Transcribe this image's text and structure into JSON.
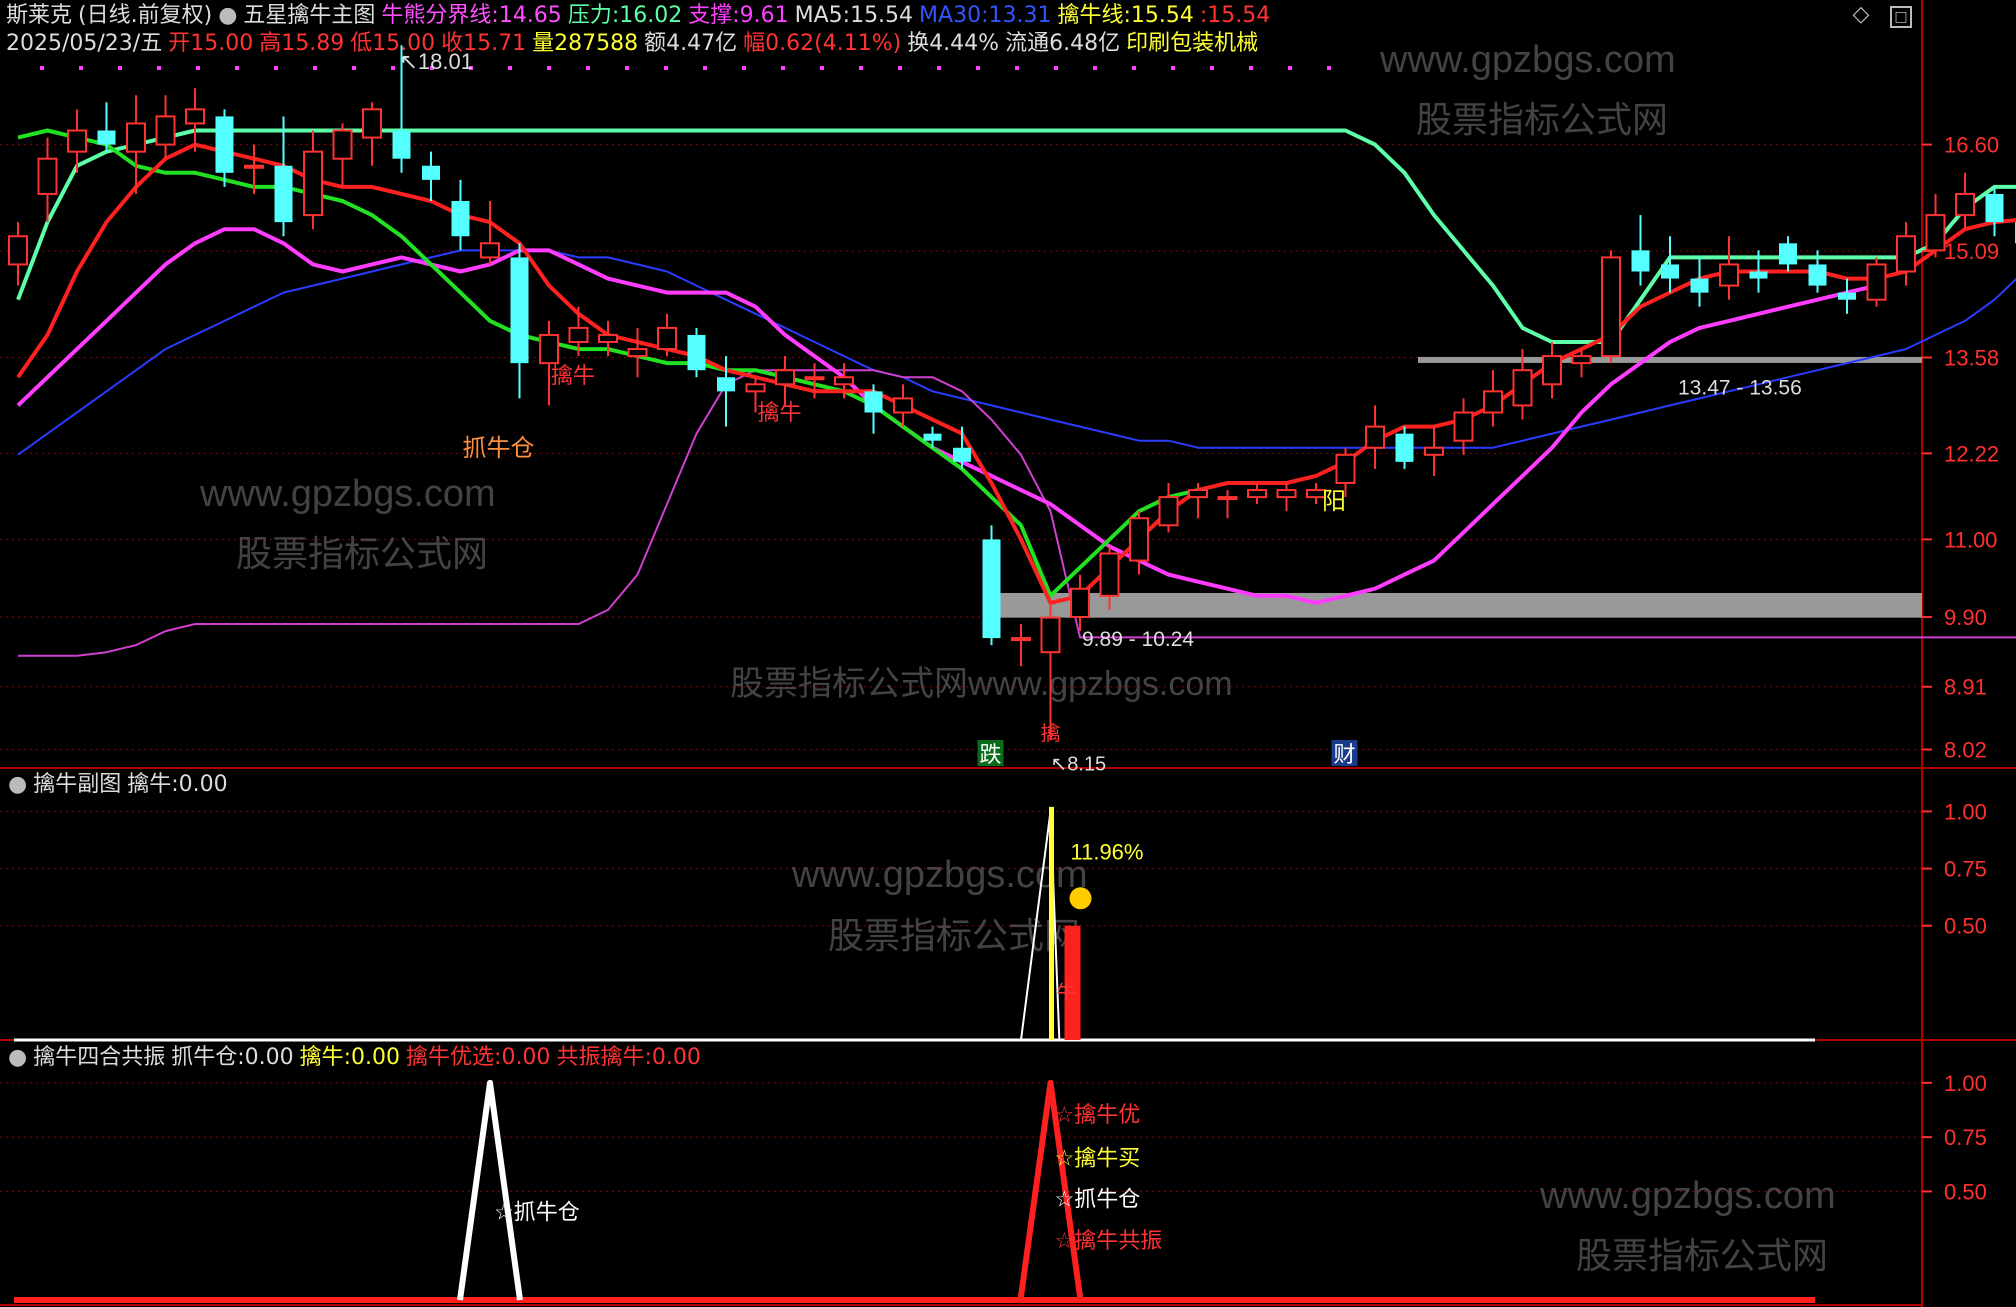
{
  "header": {
    "stock_name": "斯莱克",
    "period": "(日线.前复权)",
    "indicator": "五星擒牛主图",
    "items": [
      {
        "label": "牛熊分界线:",
        "value": "14.65",
        "color": "#ff4fff"
      },
      {
        "label": "压力:",
        "value": "16.02",
        "color": "#5dffa8"
      },
      {
        "label": "支撑:",
        "value": "9.61",
        "color": "#ff40ff"
      },
      {
        "label": "MA5:",
        "value": "15.54",
        "color": "#dddddd"
      },
      {
        "label": "MA30:",
        "value": "13.31",
        "color": "#3355ff"
      },
      {
        "label": "擒牛线:",
        "value": "15.54",
        "color": "#ffff33"
      },
      {
        "label": ":",
        "value": "15.54",
        "color": "#ff3333"
      }
    ],
    "row2": [
      {
        "label": "2025/05/23/五",
        "value": "",
        "color": "#dddddd"
      },
      {
        "label": "开",
        "value": "15.00",
        "color": "#ff3333"
      },
      {
        "label": "高",
        "value": "15.89",
        "color": "#ff3333"
      },
      {
        "label": "低",
        "value": "15.00",
        "color": "#ff3333"
      },
      {
        "label": "收",
        "value": "15.71",
        "color": "#ff3333"
      },
      {
        "label": "量",
        "value": "287588",
        "color": "#ffff33"
      },
      {
        "label": "额",
        "value": "4.47亿",
        "color": "#dddddd"
      },
      {
        "label": "幅",
        "value": "0.62(4.11%)",
        "color": "#ff3333"
      },
      {
        "label": "换",
        "value": "4.44%",
        "color": "#dddddd"
      },
      {
        "label": "流通",
        "value": "6.48亿",
        "color": "#dddddd"
      },
      {
        "label": "印刷包装机械",
        "value": "",
        "color": "#ffff33"
      }
    ],
    "sub1_title": "擒牛副图",
    "sub1_items": [
      {
        "label": "擒牛:",
        "value": "0.00",
        "color": "#dddddd"
      }
    ],
    "sub2_title": "擒牛四合共振",
    "sub2_items": [
      {
        "label": "抓牛仓:",
        "value": "0.00",
        "color": "#dddddd"
      },
      {
        "label": "擒牛:",
        "value": "0.00",
        "color": "#ffff33"
      },
      {
        "label": "擒牛优选:",
        "value": "0.00",
        "color": "#ff3333"
      },
      {
        "label": "共振擒牛:",
        "value": "0.00",
        "color": "#ff3333"
      }
    ]
  },
  "watermarks": [
    "www.gpzbgs.com",
    "股票指标公式网",
    "股票指标公式网www.gpzbgs.com"
  ],
  "chart_data": [
    {
      "type": "candlestick",
      "ylim": [
        7.8,
        17.8
      ],
      "y_ticks": [
        16.6,
        15.09,
        13.58,
        12.22,
        11.0,
        9.9,
        8.91,
        8.02
      ],
      "bars_ohlc": [
        [
          14.9,
          15.5,
          14.6,
          15.3
        ],
        [
          15.9,
          16.7,
          15.5,
          16.4
        ],
        [
          16.5,
          17.1,
          16.2,
          16.8
        ],
        [
          16.8,
          17.2,
          16.5,
          16.6
        ],
        [
          16.5,
          17.3,
          15.9,
          16.9
        ],
        [
          16.6,
          17.3,
          16.4,
          17.0
        ],
        [
          16.9,
          17.4,
          16.5,
          17.1
        ],
        [
          17.0,
          17.1,
          16.0,
          16.2
        ],
        [
          16.3,
          16.6,
          15.9,
          16.3
        ],
        [
          16.3,
          17.0,
          15.3,
          15.5
        ],
        [
          15.6,
          16.8,
          15.4,
          16.5
        ],
        [
          16.4,
          16.9,
          16.0,
          16.8
        ],
        [
          16.7,
          17.2,
          16.3,
          17.1
        ],
        [
          16.8,
          18.01,
          16.2,
          16.4
        ],
        [
          16.3,
          16.5,
          15.8,
          16.1
        ],
        [
          15.8,
          16.1,
          15.1,
          15.3
        ],
        [
          15.0,
          15.8,
          14.9,
          15.2
        ],
        [
          15.0,
          15.2,
          13.0,
          13.5
        ],
        [
          13.5,
          14.1,
          12.9,
          13.9
        ],
        [
          13.8,
          14.3,
          13.6,
          14.0
        ],
        [
          13.8,
          14.1,
          13.6,
          13.9
        ],
        [
          13.6,
          14.0,
          13.3,
          13.7
        ],
        [
          13.7,
          14.2,
          13.6,
          14.0
        ],
        [
          13.9,
          14.0,
          13.3,
          13.4
        ],
        [
          13.3,
          13.6,
          12.6,
          13.1
        ],
        [
          13.1,
          13.3,
          12.8,
          13.2
        ],
        [
          13.2,
          13.6,
          12.9,
          13.4
        ],
        [
          13.3,
          13.5,
          13.0,
          13.3
        ],
        [
          13.2,
          13.5,
          13.0,
          13.3
        ],
        [
          13.1,
          13.2,
          12.5,
          12.8
        ],
        [
          12.8,
          13.2,
          12.6,
          13.0
        ],
        [
          12.5,
          12.6,
          12.3,
          12.4
        ],
        [
          12.3,
          12.6,
          12.0,
          12.1
        ],
        [
          11.0,
          11.2,
          9.5,
          9.6
        ],
        [
          9.6,
          9.8,
          9.2,
          9.6
        ],
        [
          9.4,
          10.1,
          8.15,
          9.89
        ],
        [
          9.9,
          10.5,
          9.7,
          10.3
        ],
        [
          10.2,
          10.9,
          10.0,
          10.8
        ],
        [
          10.7,
          11.4,
          10.5,
          11.3
        ],
        [
          11.2,
          11.8,
          11.1,
          11.6
        ],
        [
          11.6,
          11.8,
          11.3,
          11.7
        ],
        [
          11.6,
          11.7,
          11.3,
          11.6
        ],
        [
          11.6,
          11.8,
          11.5,
          11.7
        ],
        [
          11.6,
          11.8,
          11.4,
          11.7
        ],
        [
          11.6,
          11.8,
          11.5,
          11.7
        ],
        [
          11.8,
          12.3,
          11.6,
          12.2
        ],
        [
          12.3,
          12.9,
          12.0,
          12.6
        ],
        [
          12.5,
          12.6,
          12.0,
          12.1
        ],
        [
          12.2,
          12.6,
          11.9,
          12.3
        ],
        [
          12.4,
          13.0,
          12.2,
          12.8
        ],
        [
          12.8,
          13.4,
          12.6,
          13.1
        ],
        [
          12.9,
          13.7,
          12.7,
          13.4
        ],
        [
          13.2,
          13.8,
          13.0,
          13.6
        ],
        [
          13.5,
          13.7,
          13.3,
          13.6
        ],
        [
          13.6,
          15.1,
          13.5,
          15.0
        ],
        [
          15.1,
          15.6,
          14.6,
          14.8
        ],
        [
          14.9,
          15.3,
          14.5,
          14.7
        ],
        [
          14.7,
          15.0,
          14.3,
          14.5
        ],
        [
          14.6,
          15.3,
          14.4,
          14.9
        ],
        [
          14.8,
          15.1,
          14.5,
          14.7
        ],
        [
          15.2,
          15.3,
          14.8,
          14.9
        ],
        [
          14.9,
          15.1,
          14.5,
          14.6
        ],
        [
          14.5,
          14.7,
          14.2,
          14.4
        ],
        [
          14.4,
          15.0,
          14.3,
          14.9
        ],
        [
          14.8,
          15.5,
          14.6,
          15.3
        ],
        [
          15.1,
          15.9,
          15.0,
          15.6
        ],
        [
          15.6,
          16.2,
          15.4,
          15.9
        ],
        [
          15.9,
          16.0,
          15.3,
          15.5
        ],
        [
          15.5,
          15.8,
          15.0,
          15.2
        ],
        [
          15.0,
          15.89,
          15.0,
          15.71
        ]
      ],
      "lines": {
        "resistance": [
          14.4,
          15.5,
          16.3,
          16.5,
          16.6,
          16.7,
          16.8,
          16.8,
          16.8,
          16.8,
          16.8,
          16.8,
          16.8,
          16.8,
          16.8,
          16.8,
          16.8,
          16.8,
          16.8,
          16.8,
          16.8,
          16.8,
          16.8,
          16.8,
          16.8,
          16.8,
          16.8,
          16.8,
          16.8,
          16.8,
          16.8,
          16.8,
          16.8,
          16.8,
          16.8,
          16.8,
          16.8,
          16.8,
          16.8,
          16.8,
          16.8,
          16.8,
          16.8,
          16.8,
          16.8,
          16.8,
          16.6,
          16.2,
          15.6,
          15.1,
          14.6,
          14.0,
          13.8,
          13.8,
          13.8,
          14.4,
          15.0,
          15.0,
          15.0,
          15.0,
          15.0,
          15.0,
          15.0,
          15.0,
          15.0,
          15.2,
          15.7,
          16.0,
          16.0,
          16.0
        ],
        "bull_line": [
          13.3,
          13.9,
          14.8,
          15.5,
          16.0,
          16.4,
          16.6,
          16.5,
          16.4,
          16.3,
          16.1,
          16.0,
          16.0,
          15.9,
          15.8,
          15.6,
          15.5,
          15.2,
          14.6,
          14.2,
          13.9,
          13.8,
          13.7,
          13.6,
          13.4,
          13.3,
          13.2,
          13.1,
          13.1,
          13.1,
          12.9,
          12.7,
          12.5,
          11.8,
          11.0,
          10.1,
          10.2,
          10.6,
          11.0,
          11.4,
          11.7,
          11.8,
          11.8,
          11.8,
          11.9,
          12.1,
          12.4,
          12.6,
          12.6,
          12.7,
          12.9,
          13.2,
          13.5,
          13.7,
          13.9,
          14.3,
          14.5,
          14.7,
          14.8,
          14.8,
          14.8,
          14.8,
          14.7,
          14.7,
          14.8,
          15.1,
          15.4,
          15.5,
          15.54,
          15.54
        ],
        "ma_green": [
          16.7,
          16.8,
          16.7,
          16.6,
          16.3,
          16.2,
          16.2,
          16.1,
          16.0,
          16.0,
          15.9,
          15.8,
          15.6,
          15.3,
          14.9,
          14.5,
          14.1,
          13.9,
          13.8,
          13.7,
          13.7,
          13.6,
          13.5,
          13.5,
          13.4,
          13.4,
          13.3,
          13.2,
          13.1,
          12.9,
          12.6,
          12.3,
          12.0,
          11.6,
          11.2,
          10.2,
          10.6,
          11.0,
          11.4,
          11.6,
          11.7
        ],
        "bear_bull": [
          12.9,
          13.3,
          13.7,
          14.1,
          14.5,
          14.9,
          15.2,
          15.4,
          15.4,
          15.2,
          14.9,
          14.8,
          14.9,
          15.0,
          14.9,
          14.8,
          14.9,
          15.1,
          15.1,
          14.9,
          14.7,
          14.6,
          14.5,
          14.5,
          14.5,
          14.3,
          13.9,
          13.6,
          13.3,
          12.9,
          12.6,
          12.3,
          12.1,
          11.9,
          11.7,
          11.5,
          11.2,
          10.9,
          10.7,
          10.5,
          10.4,
          10.3,
          10.2,
          10.2,
          10.1,
          10.2,
          10.3,
          10.5,
          10.7,
          11.1,
          11.5,
          11.9,
          12.3,
          12.8,
          13.2,
          13.5,
          13.8,
          14.0,
          14.1,
          14.2,
          14.3,
          14.4,
          14.5,
          14.6
        ],
        "ma30": [
          12.2,
          12.5,
          12.8,
          13.1,
          13.4,
          13.7,
          13.9,
          14.1,
          14.3,
          14.5,
          14.6,
          14.7,
          14.8,
          14.9,
          15.0,
          15.1,
          15.1,
          15.1,
          15.1,
          15.0,
          15.0,
          14.9,
          14.8,
          14.6,
          14.4,
          14.2,
          14.0,
          13.8,
          13.6,
          13.4,
          13.3,
          13.1,
          13.0,
          12.9,
          12.8,
          12.7,
          12.6,
          12.5,
          12.4,
          12.4,
          12.3,
          12.3,
          12.3,
          12.3,
          12.3,
          12.3,
          12.3,
          12.3,
          12.3,
          12.3,
          12.3,
          12.4,
          12.5,
          12.6,
          12.7,
          12.8,
          12.9,
          13.0,
          13.1,
          13.2,
          13.3,
          13.4,
          13.5,
          13.6,
          13.7,
          13.9,
          14.1,
          14.4,
          14.8,
          15.2
        ],
        "support": [
          9.35,
          9.35,
          9.35,
          9.4,
          9.5,
          9.7,
          9.8,
          9.8,
          9.8,
          9.8,
          9.8,
          9.8,
          9.8,
          9.8,
          9.8,
          9.8,
          9.8,
          9.8,
          9.8,
          9.8,
          10.0,
          10.5,
          11.5,
          12.5,
          13.2,
          13.4,
          13.4,
          13.4,
          13.4,
          13.4,
          13.3,
          13.3,
          13.1,
          12.7,
          12.2,
          11.4,
          9.61,
          9.61,
          9.61,
          9.61,
          9.61,
          9.61,
          9.61,
          9.61,
          9.61,
          9.61,
          9.61,
          9.61,
          9.61,
          9.61,
          9.61,
          9.61,
          9.61,
          9.61,
          9.61,
          9.61,
          9.61,
          9.61,
          9.61,
          9.61,
          9.61,
          9.61,
          9.61,
          9.61,
          9.61,
          9.61,
          9.61,
          9.61,
          9.61
        ]
      },
      "annotations": [
        {
          "text": "18.01",
          "kind": "price-high"
        },
        {
          "text": "8.15",
          "kind": "price-low"
        },
        {
          "text": "擒牛",
          "kind": "signal"
        },
        {
          "text": "擒牛",
          "kind": "signal"
        },
        {
          "text": "抓牛仓",
          "kind": "signal"
        },
        {
          "text": "阳",
          "kind": "signal"
        },
        {
          "text": "9.89 - 10.24",
          "kind": "band-range"
        },
        {
          "text": "13.47 - 13.56",
          "kind": "band-range"
        },
        {
          "text": "跌",
          "kind": "tag"
        },
        {
          "text": "财",
          "kind": "tag"
        },
        {
          "text": "擒",
          "kind": "signal"
        }
      ],
      "bands": [
        {
          "low": 9.89,
          "high": 10.24
        },
        {
          "low": 13.47,
          "high": 13.56
        }
      ]
    },
    {
      "type": "line",
      "title": "擒牛副图",
      "ylim": [
        0,
        1.05
      ],
      "y_ticks": [
        1.0,
        0.75,
        0.5
      ],
      "peak_index": 35,
      "annotations": [
        {
          "text": "11.96%",
          "kind": "percent"
        },
        {
          "text": "牛",
          "kind": "signal"
        }
      ]
    },
    {
      "type": "line",
      "title": "擒牛四合共振",
      "ylim": [
        0,
        1.05
      ],
      "y_ticks": [
        1.0,
        0.75,
        0.5
      ],
      "peaks": [
        {
          "index": 16,
          "color": "#ffffff",
          "labels": [
            "抓牛仓"
          ]
        },
        {
          "index": 35,
          "color": "#ff2020",
          "labels": [
            "擒牛优",
            "擒牛买",
            "抓牛仓",
            "擒牛共振"
          ]
        }
      ]
    }
  ],
  "colors": {
    "up": "#ff3232",
    "down": "#54ffff",
    "grid": "#8b0000",
    "axis_text": "#ff3030",
    "resistance": "#5dffa8",
    "bull_line": "#ff2020",
    "bull_line_flat": "#ffd700",
    "ma_green": "#22e022",
    "bear_bull": "#ff3cff",
    "ma30": "#2a3cff",
    "support": "#d040d0",
    "band": "#999999"
  },
  "icons": [
    "diamond-icon",
    "maximize-icon",
    "collapse-icon"
  ]
}
